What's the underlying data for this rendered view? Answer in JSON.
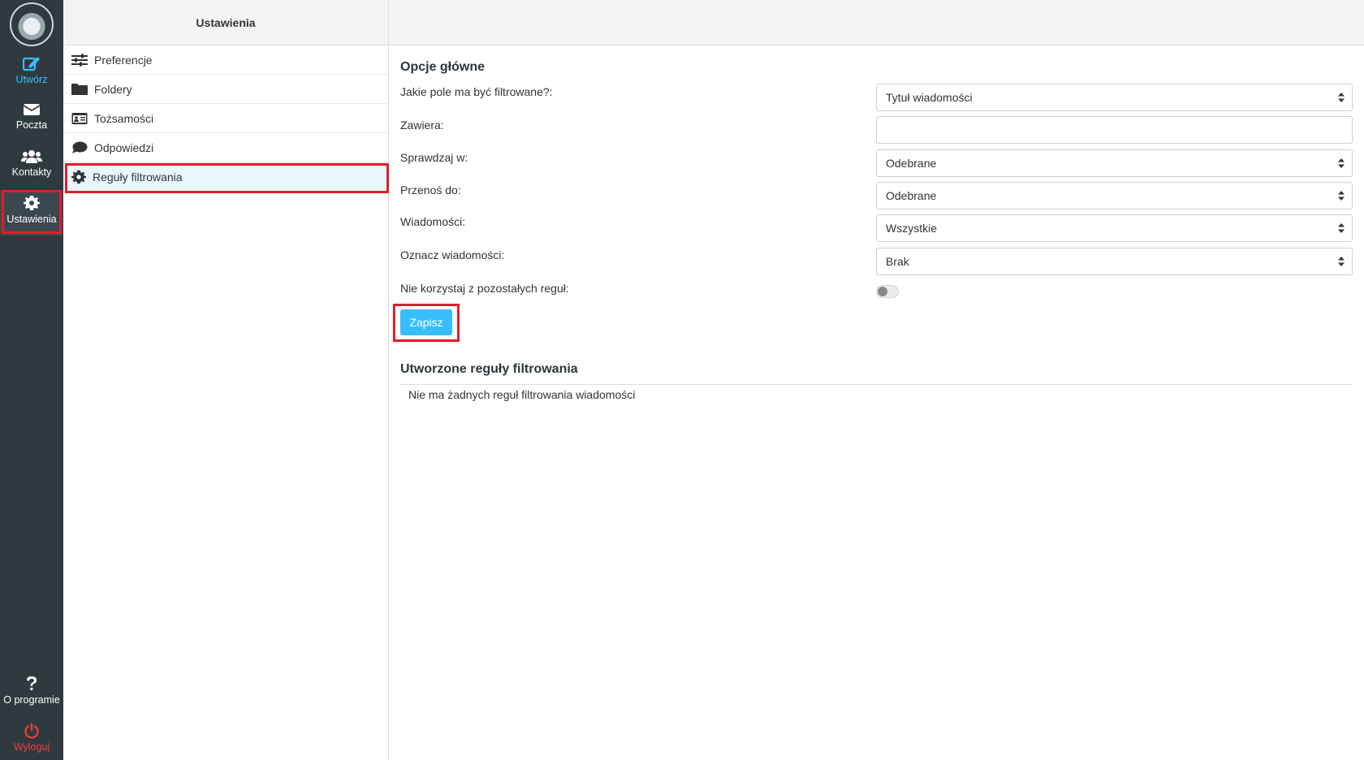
{
  "rail": {
    "compose": "Utwórz",
    "mail": "Poczta",
    "contacts": "Kontakty",
    "settings": "Ustawienia",
    "about": "O programie",
    "logout": "Wyloguj"
  },
  "settings_list": {
    "header": "Ustawienia",
    "items": [
      {
        "label": "Preferencje",
        "icon": "sliders-icon"
      },
      {
        "label": "Foldery",
        "icon": "folder-icon"
      },
      {
        "label": "Tożsamości",
        "icon": "id-card-icon"
      },
      {
        "label": "Odpowiedzi",
        "icon": "comment-icon"
      },
      {
        "label": "Reguły filtrowania",
        "icon": "gear-icon",
        "selected": true
      }
    ]
  },
  "form": {
    "title": "Opcje główne",
    "field_label": "Jakie pole ma być filtrowane?:",
    "field_value": "Tytuł wiadomości",
    "contains_label": "Zawiera:",
    "contains_value": "",
    "check_in_label": "Sprawdzaj w:",
    "check_in_value": "Odebrane",
    "move_to_label": "Przenoś do:",
    "move_to_value": "Odebrane",
    "messages_label": "Wiadomości:",
    "messages_value": "Wszystkie",
    "mark_label": "Oznacz wiadomości:",
    "mark_value": "Brak",
    "stop_rules_label": "Nie korzystaj z pozostałych reguł:",
    "stop_rules_enabled": false,
    "save_label": "Zapisz"
  },
  "rules": {
    "title": "Utworzone reguły filtrowania",
    "empty_message": "Nie ma żadnych reguł filtrowania wiadomości"
  },
  "colors": {
    "accent": "#37beff",
    "rail_bg": "#2f3a3f",
    "logout": "#ef3b3b",
    "highlight": "#e01e2a"
  }
}
